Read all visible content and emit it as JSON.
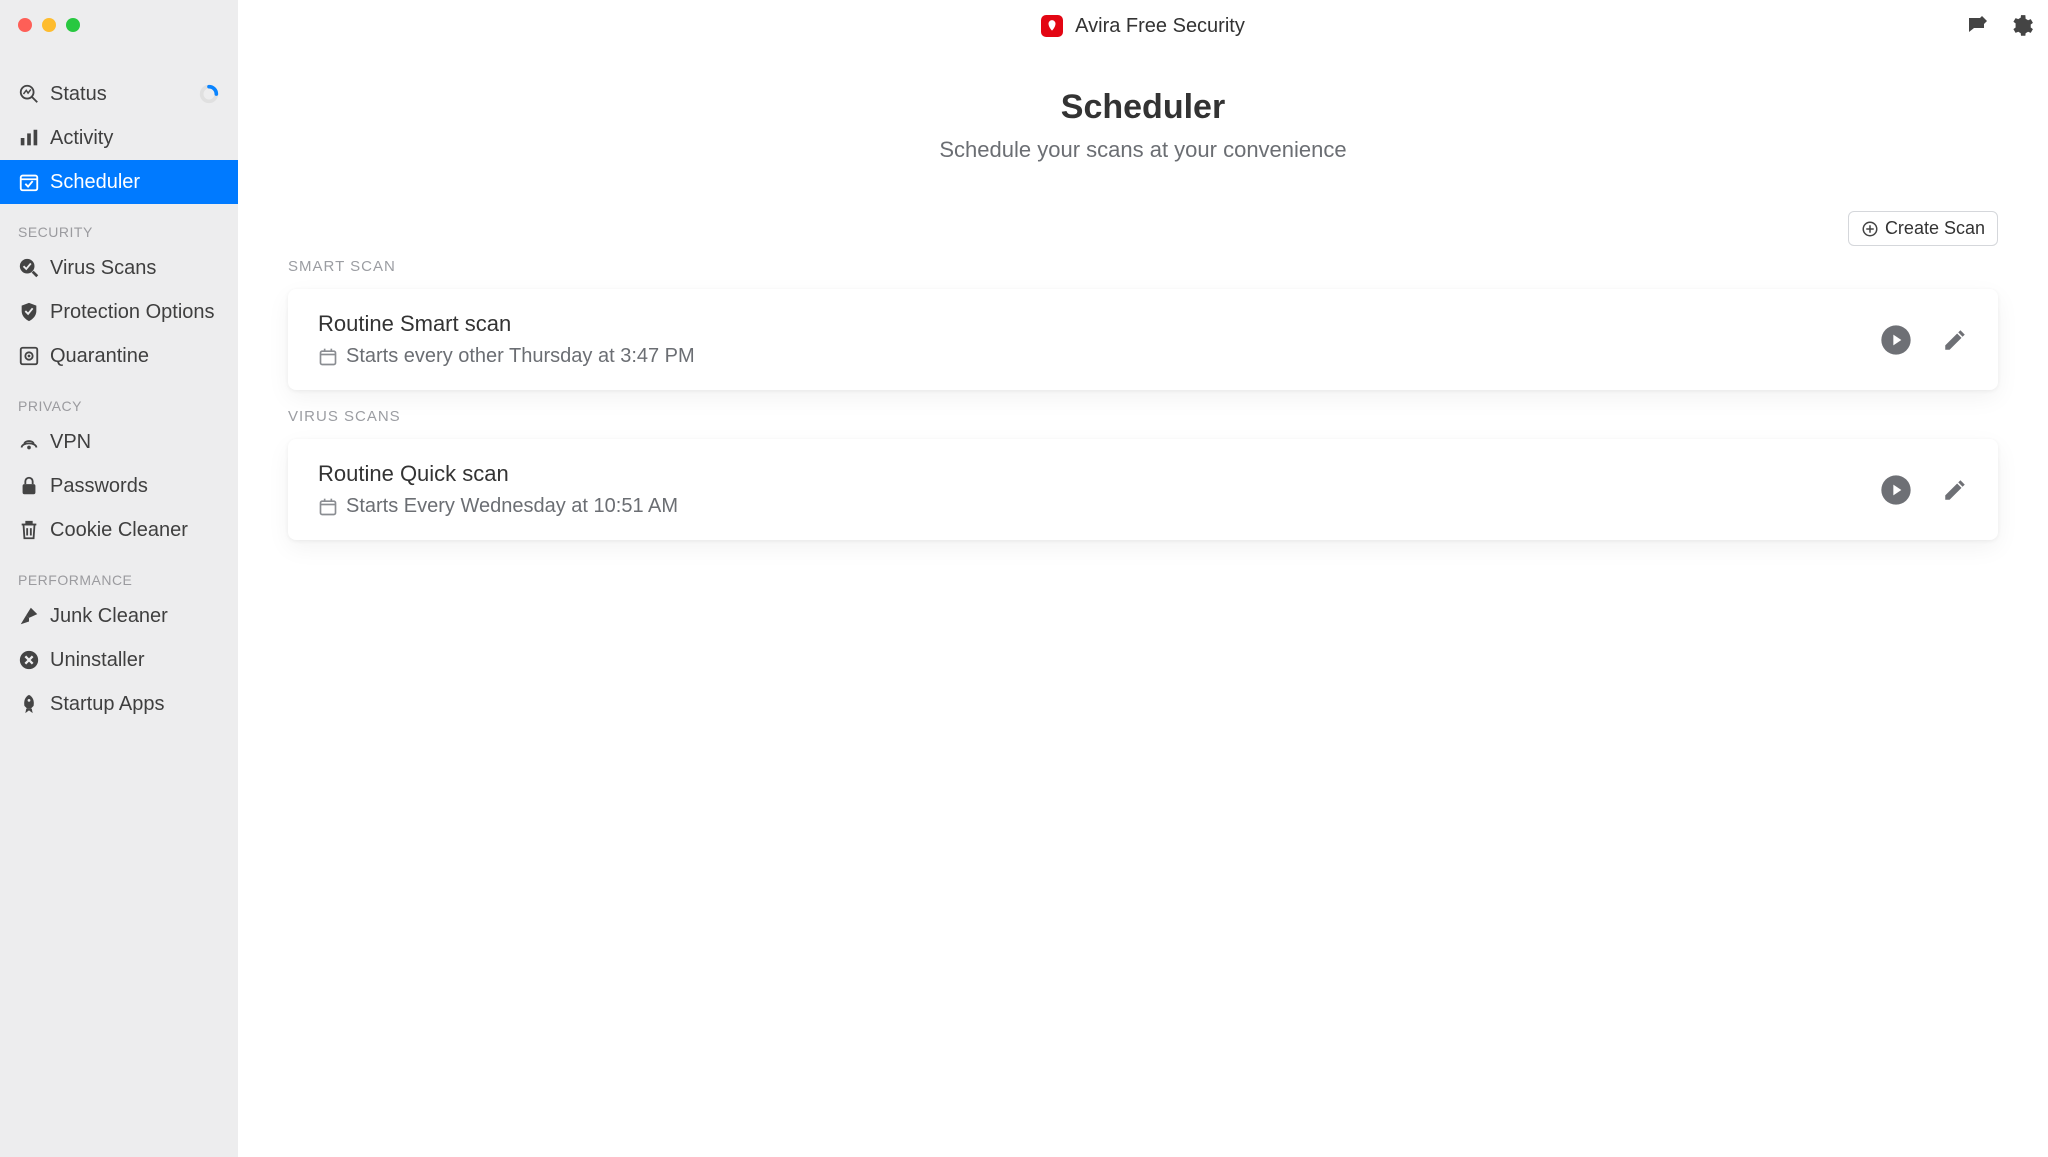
{
  "header": {
    "app_title": "Avira Free Security"
  },
  "sidebar": {
    "top": [
      {
        "label": "Status",
        "icon": "status"
      },
      {
        "label": "Activity",
        "icon": "activity"
      },
      {
        "label": "Scheduler",
        "icon": "scheduler"
      }
    ],
    "groups": [
      {
        "title": "SECURITY",
        "items": [
          {
            "label": "Virus Scans",
            "icon": "virus-scans"
          },
          {
            "label": "Protection Options",
            "icon": "protection"
          },
          {
            "label": "Quarantine",
            "icon": "quarantine"
          }
        ]
      },
      {
        "title": "PRIVACY",
        "items": [
          {
            "label": "VPN",
            "icon": "vpn"
          },
          {
            "label": "Passwords",
            "icon": "passwords"
          },
          {
            "label": "Cookie Cleaner",
            "icon": "cookie"
          }
        ]
      },
      {
        "title": "PERFORMANCE",
        "items": [
          {
            "label": "Junk Cleaner",
            "icon": "junk"
          },
          {
            "label": "Uninstaller",
            "icon": "uninstaller"
          },
          {
            "label": "Startup Apps",
            "icon": "startup"
          }
        ]
      }
    ]
  },
  "page": {
    "title": "Scheduler",
    "subtitle": "Schedule your scans at your convenience",
    "create_label": "Create Scan",
    "sections": [
      {
        "label": "SMART SCAN",
        "cards": [
          {
            "title": "Routine Smart scan",
            "schedule_text": "Starts every other Thursday at 3:47 PM"
          }
        ]
      },
      {
        "label": "VIRUS SCANS",
        "cards": [
          {
            "title": "Routine Quick scan",
            "schedule_text": "Starts Every Wednesday at 10:51 AM"
          }
        ]
      }
    ]
  }
}
